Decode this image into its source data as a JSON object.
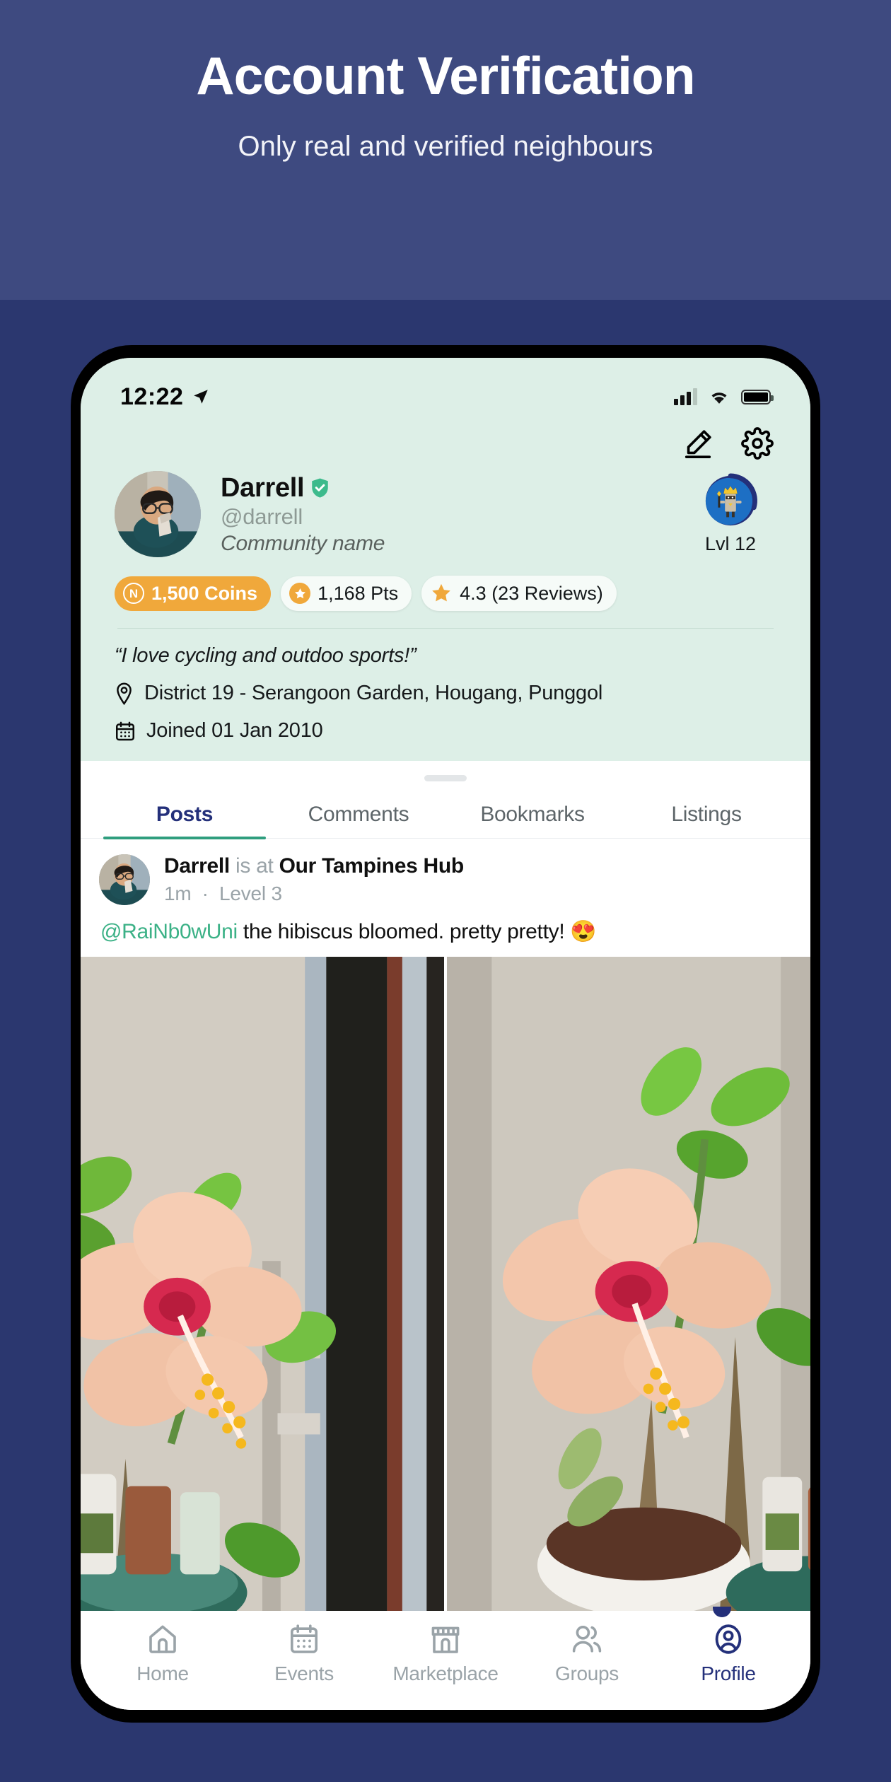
{
  "promo": {
    "title": "Account Verification",
    "subtitle": "Only real and verified neighbours",
    "band_color": "#3e4a80",
    "page_bg_color": "#2b376f"
  },
  "status_bar": {
    "time": "12:22",
    "location_icon": "location-arrow-icon",
    "signal_icon": "cellular-signal-icon",
    "wifi_icon": "wifi-icon",
    "battery_icon": "battery-full-icon"
  },
  "header_actions": {
    "edit_icon": "edit-pencil-icon",
    "settings_icon": "gear-icon"
  },
  "profile": {
    "name": "Darrell",
    "verified_icon": "verified-shield-icon",
    "verified_color": "#3cba8c",
    "handle": "@darrell",
    "community": "Community name",
    "avatar_icon": "user-avatar-photo",
    "level_label": "Lvl 12",
    "level_badge_icon": "king-character-icon",
    "level_badge_color": "#1d6fc4",
    "bio": "“I love cycling and outdoo sports!”",
    "location_icon": "map-pin-icon",
    "location": "District 19 - Serangoon Garden, Hougang, Punggol",
    "calendar_icon": "calendar-icon",
    "joined": "Joined 01 Jan 2010",
    "chips": [
      {
        "label": "1,500 Coins",
        "icon": "coin-icon",
        "style": "coins",
        "icon_text": "N"
      },
      {
        "label": "1,168 Pts",
        "icon": "star-circle-icon",
        "style": "light"
      },
      {
        "label": "4.3 (23 Reviews)",
        "icon": "star-icon",
        "style": "light"
      }
    ]
  },
  "tabs": [
    {
      "label": "Posts",
      "active": true
    },
    {
      "label": "Comments",
      "active": false
    },
    {
      "label": "Bookmarks",
      "active": false
    },
    {
      "label": "Listings",
      "active": false
    }
  ],
  "post": {
    "author": "Darrell",
    "connector": "is at",
    "place": "Our Tampines Hub",
    "time": "1m",
    "separator": "·",
    "level": "Level 3",
    "mention": "@RaiNb0wUni",
    "text": " the hibiscus bloomed. pretty pretty! 😍",
    "photo_count": 2,
    "photo_alt_1": "hibiscus-flower-photo-left",
    "photo_alt_2": "hibiscus-flower-photo-right"
  },
  "bottom_nav": [
    {
      "label": "Home",
      "icon": "home-icon",
      "active": false
    },
    {
      "label": "Events",
      "icon": "calendar-icon",
      "active": false
    },
    {
      "label": "Marketplace",
      "icon": "storefront-icon",
      "active": false
    },
    {
      "label": "Groups",
      "icon": "people-icon",
      "active": false
    },
    {
      "label": "Profile",
      "icon": "person-circle-icon",
      "active": true
    }
  ]
}
